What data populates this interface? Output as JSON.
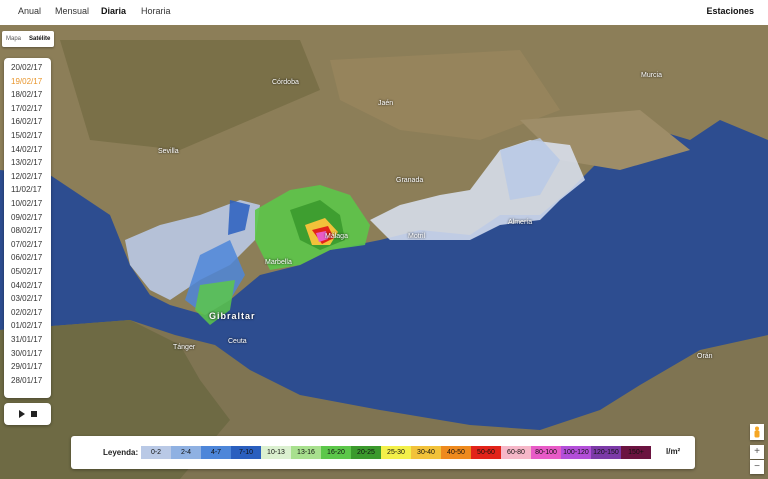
{
  "tabs": [
    {
      "label": "Anual"
    },
    {
      "label": "Mensual"
    },
    {
      "label": "Diaria"
    },
    {
      "label": "Horaria"
    }
  ],
  "stations_label": "Estaciones",
  "map_type": {
    "map": "Mapa",
    "satellite": "Satélite"
  },
  "dates": [
    "20/02/17",
    "19/02/17",
    "18/02/17",
    "17/02/17",
    "16/02/17",
    "15/02/17",
    "14/02/17",
    "13/02/17",
    "12/02/17",
    "11/02/17",
    "10/02/17",
    "09/02/17",
    "08/02/17",
    "07/02/17",
    "06/02/17",
    "05/02/17",
    "04/02/17",
    "03/02/17",
    "02/02/17",
    "01/02/17",
    "31/01/17",
    "30/01/17",
    "29/01/17",
    "28/01/17"
  ],
  "selected_date": "19/02/17",
  "legend": {
    "title": "Leyenda:",
    "unit": "l/m²",
    "ranges": [
      {
        "label": "0-2",
        "color": "#b9c9e6"
      },
      {
        "label": "2-4",
        "color": "#8fb1e2"
      },
      {
        "label": "4-7",
        "color": "#4d86d9"
      },
      {
        "label": "7-10",
        "color": "#2a5fbf"
      },
      {
        "label": "10-13",
        "color": "#dbf0d0"
      },
      {
        "label": "13-16",
        "color": "#a8e08e"
      },
      {
        "label": "16-20",
        "color": "#5cc74a"
      },
      {
        "label": "20-25",
        "color": "#3b9a2d"
      },
      {
        "label": "25-30",
        "color": "#f3f04a"
      },
      {
        "label": "30-40",
        "color": "#f2c23a"
      },
      {
        "label": "40-50",
        "color": "#ee8a1e"
      },
      {
        "label": "50-60",
        "color": "#e2231a"
      },
      {
        "label": "60-80",
        "color": "#f6b7c8"
      },
      {
        "label": "80-100",
        "color": "#e85bc7"
      },
      {
        "label": "100-120",
        "color": "#b34fd9"
      },
      {
        "label": "120-150",
        "color": "#7c3aa8"
      },
      {
        "label": "150+",
        "color": "#6b1340"
      }
    ]
  },
  "map_labels": {
    "gibraltar": "Gibraltar",
    "sevilla": "Sevilla",
    "granada": "Granada",
    "murcia": "Murcia",
    "malaga": "Málaga",
    "almeria": "Almería",
    "tanger": "Tánger",
    "oran": "Orán",
    "ceuta": "Ceuta",
    "jaen": "Jaén",
    "cordoba": "Córdoba",
    "marbella": "Marbella",
    "motril": "Motril"
  },
  "zoom": {
    "in": "+",
    "out": "−"
  }
}
